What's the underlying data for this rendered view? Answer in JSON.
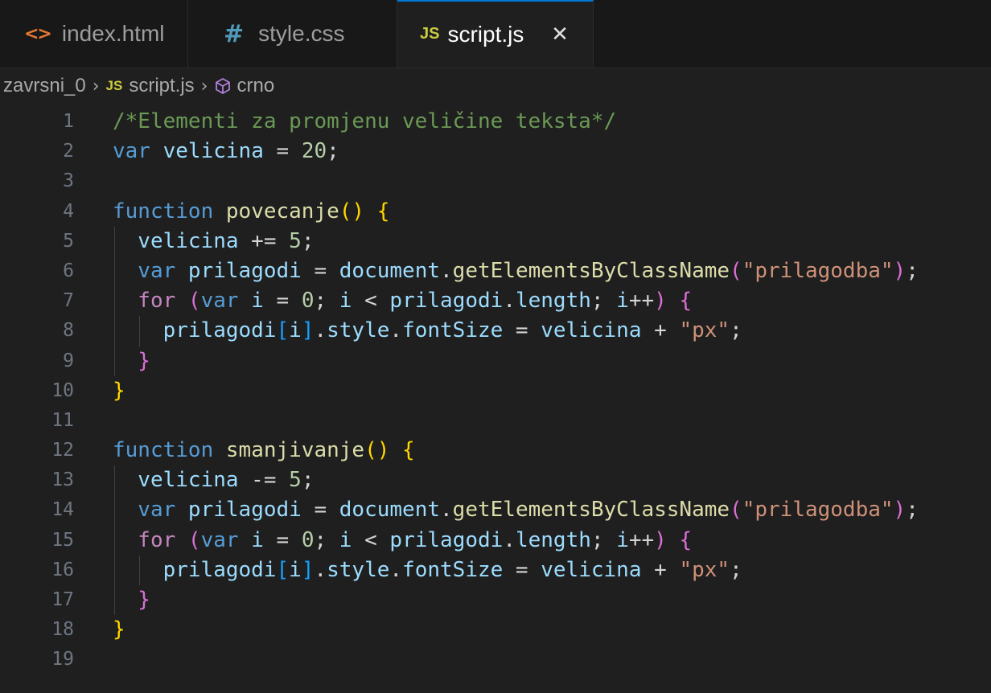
{
  "tabs": [
    {
      "id": "html",
      "icon": "html-file-icon",
      "icon_glyph": "<>",
      "label": "index.html"
    },
    {
      "id": "css",
      "icon": "css-file-icon",
      "icon_glyph": "#",
      "label": "style.css"
    },
    {
      "id": "js",
      "icon": "js-file-icon",
      "icon_glyph": "JS",
      "label": "script.js",
      "active": true,
      "close_glyph": "✕"
    }
  ],
  "breadcrumb": {
    "folder": "zavrsni_0",
    "separator": "›",
    "file_icon": "JS",
    "file": "script.js",
    "symbol_icon": "cube-icon",
    "symbol": "crno"
  },
  "code_lines": [
    {
      "n": "1",
      "indent": 0,
      "tokens": [
        {
          "t": "/*Elementi za promjenu veličine teksta*/",
          "c": "comment"
        }
      ]
    },
    {
      "n": "2",
      "indent": 0,
      "tokens": [
        {
          "t": "var ",
          "c": "kw"
        },
        {
          "t": "velicina",
          "c": "var"
        },
        {
          "t": " = ",
          "c": "op"
        },
        {
          "t": "20",
          "c": "num"
        },
        {
          "t": ";",
          "c": "op"
        }
      ]
    },
    {
      "n": "3",
      "indent": 0,
      "tokens": []
    },
    {
      "n": "4",
      "indent": 0,
      "tokens": [
        {
          "t": "function ",
          "c": "kw"
        },
        {
          "t": "povecanje",
          "c": "fn"
        },
        {
          "t": "()",
          "c": "b1"
        },
        {
          "t": " ",
          "c": "op"
        },
        {
          "t": "{",
          "c": "b1"
        }
      ]
    },
    {
      "n": "5",
      "indent": 1,
      "tokens": [
        {
          "t": "velicina",
          "c": "var"
        },
        {
          "t": " += ",
          "c": "op"
        },
        {
          "t": "5",
          "c": "num"
        },
        {
          "t": ";",
          "c": "op"
        }
      ]
    },
    {
      "n": "6",
      "indent": 1,
      "tokens": [
        {
          "t": "var ",
          "c": "kw"
        },
        {
          "t": "prilagodi",
          "c": "var"
        },
        {
          "t": " = ",
          "c": "op"
        },
        {
          "t": "document",
          "c": "var"
        },
        {
          "t": ".",
          "c": "op"
        },
        {
          "t": "getElementsByClassName",
          "c": "fn"
        },
        {
          "t": "(",
          "c": "b2"
        },
        {
          "t": "\"prilagodba\"",
          "c": "str"
        },
        {
          "t": ")",
          "c": "b2"
        },
        {
          "t": ";",
          "c": "op"
        }
      ]
    },
    {
      "n": "7",
      "indent": 1,
      "tokens": [
        {
          "t": "for ",
          "c": "ctrl"
        },
        {
          "t": "(",
          "c": "b2"
        },
        {
          "t": "var ",
          "c": "kw"
        },
        {
          "t": "i",
          "c": "var"
        },
        {
          "t": " = ",
          "c": "op"
        },
        {
          "t": "0",
          "c": "num"
        },
        {
          "t": "; ",
          "c": "op"
        },
        {
          "t": "i",
          "c": "var"
        },
        {
          "t": " < ",
          "c": "op"
        },
        {
          "t": "prilagodi",
          "c": "var"
        },
        {
          "t": ".",
          "c": "op"
        },
        {
          "t": "length",
          "c": "var"
        },
        {
          "t": "; ",
          "c": "op"
        },
        {
          "t": "i",
          "c": "var"
        },
        {
          "t": "++",
          "c": "op"
        },
        {
          "t": ")",
          "c": "b2"
        },
        {
          "t": " ",
          "c": "op"
        },
        {
          "t": "{",
          "c": "b2"
        }
      ]
    },
    {
      "n": "8",
      "indent": 2,
      "tokens": [
        {
          "t": "prilagodi",
          "c": "var"
        },
        {
          "t": "[",
          "c": "b3"
        },
        {
          "t": "i",
          "c": "var"
        },
        {
          "t": "]",
          "c": "b3"
        },
        {
          "t": ".",
          "c": "op"
        },
        {
          "t": "style",
          "c": "var"
        },
        {
          "t": ".",
          "c": "op"
        },
        {
          "t": "fontSize",
          "c": "var"
        },
        {
          "t": " = ",
          "c": "op"
        },
        {
          "t": "velicina",
          "c": "var"
        },
        {
          "t": " + ",
          "c": "op"
        },
        {
          "t": "\"px\"",
          "c": "str"
        },
        {
          "t": ";",
          "c": "op"
        }
      ]
    },
    {
      "n": "9",
      "indent": 1,
      "tokens": [
        {
          "t": "}",
          "c": "b2"
        }
      ]
    },
    {
      "n": "10",
      "indent": 0,
      "tokens": [
        {
          "t": "}",
          "c": "b1"
        }
      ]
    },
    {
      "n": "11",
      "indent": 0,
      "tokens": []
    },
    {
      "n": "12",
      "indent": 0,
      "tokens": [
        {
          "t": "function ",
          "c": "kw"
        },
        {
          "t": "smanjivanje",
          "c": "fn"
        },
        {
          "t": "()",
          "c": "b1"
        },
        {
          "t": " ",
          "c": "op"
        },
        {
          "t": "{",
          "c": "b1"
        }
      ]
    },
    {
      "n": "13",
      "indent": 1,
      "tokens": [
        {
          "t": "velicina",
          "c": "var"
        },
        {
          "t": " -= ",
          "c": "op"
        },
        {
          "t": "5",
          "c": "num"
        },
        {
          "t": ";",
          "c": "op"
        }
      ]
    },
    {
      "n": "14",
      "indent": 1,
      "tokens": [
        {
          "t": "var ",
          "c": "kw"
        },
        {
          "t": "prilagodi",
          "c": "var"
        },
        {
          "t": " = ",
          "c": "op"
        },
        {
          "t": "document",
          "c": "var"
        },
        {
          "t": ".",
          "c": "op"
        },
        {
          "t": "getElementsByClassName",
          "c": "fn"
        },
        {
          "t": "(",
          "c": "b2"
        },
        {
          "t": "\"prilagodba\"",
          "c": "str"
        },
        {
          "t": ")",
          "c": "b2"
        },
        {
          "t": ";",
          "c": "op"
        }
      ]
    },
    {
      "n": "15",
      "indent": 1,
      "tokens": [
        {
          "t": "for ",
          "c": "ctrl"
        },
        {
          "t": "(",
          "c": "b2"
        },
        {
          "t": "var ",
          "c": "kw"
        },
        {
          "t": "i",
          "c": "var"
        },
        {
          "t": " = ",
          "c": "op"
        },
        {
          "t": "0",
          "c": "num"
        },
        {
          "t": "; ",
          "c": "op"
        },
        {
          "t": "i",
          "c": "var"
        },
        {
          "t": " < ",
          "c": "op"
        },
        {
          "t": "prilagodi",
          "c": "var"
        },
        {
          "t": ".",
          "c": "op"
        },
        {
          "t": "length",
          "c": "var"
        },
        {
          "t": "; ",
          "c": "op"
        },
        {
          "t": "i",
          "c": "var"
        },
        {
          "t": "++",
          "c": "op"
        },
        {
          "t": ")",
          "c": "b2"
        },
        {
          "t": " ",
          "c": "op"
        },
        {
          "t": "{",
          "c": "b2"
        }
      ]
    },
    {
      "n": "16",
      "indent": 2,
      "tokens": [
        {
          "t": "prilagodi",
          "c": "var"
        },
        {
          "t": "[",
          "c": "b3"
        },
        {
          "t": "i",
          "c": "var"
        },
        {
          "t": "]",
          "c": "b3"
        },
        {
          "t": ".",
          "c": "op"
        },
        {
          "t": "style",
          "c": "var"
        },
        {
          "t": ".",
          "c": "op"
        },
        {
          "t": "fontSize",
          "c": "var"
        },
        {
          "t": " = ",
          "c": "op"
        },
        {
          "t": "velicina",
          "c": "var"
        },
        {
          "t": " + ",
          "c": "op"
        },
        {
          "t": "\"px\"",
          "c": "str"
        },
        {
          "t": ";",
          "c": "op"
        }
      ]
    },
    {
      "n": "17",
      "indent": 1,
      "tokens": [
        {
          "t": "}",
          "c": "b2"
        }
      ]
    },
    {
      "n": "18",
      "indent": 0,
      "tokens": [
        {
          "t": "}",
          "c": "b1"
        }
      ]
    },
    {
      "n": "19",
      "indent": 0,
      "tokens": []
    }
  ],
  "colors": {
    "editor_bg": "#1f1f1f",
    "tabbar_bg": "#181818",
    "active_tab_border": "#0078d4",
    "html_icon": "#e37933",
    "css_icon": "#519aba",
    "js_icon": "#cbcb41"
  }
}
